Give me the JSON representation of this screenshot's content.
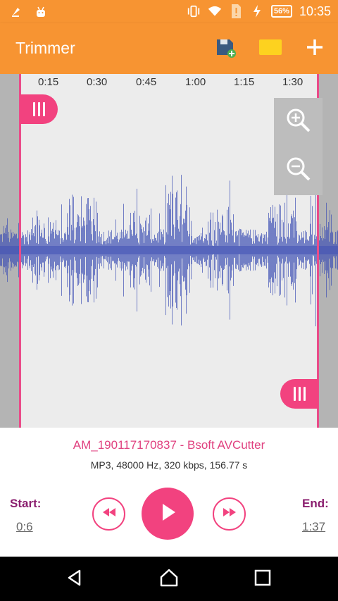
{
  "status_bar": {
    "icons": [
      "download-arrow-icon",
      "android-icon",
      "vibrate-icon",
      "wifi-icon",
      "sim-alert-icon",
      "charging-icon"
    ],
    "battery": "56%",
    "time": "10:35"
  },
  "app_bar": {
    "title": "Trimmer",
    "actions": [
      "save-icon",
      "folder-icon",
      "add-icon"
    ]
  },
  "timeline": {
    "ticks": [
      "0:15",
      "0:30",
      "0:45",
      "1:00",
      "1:15",
      "1:30"
    ]
  },
  "zoom": {
    "icons": [
      "zoom-in-icon",
      "zoom-out-icon"
    ]
  },
  "file": {
    "name": "AM_190117170837 - Bsoft AVCutter",
    "info": "MP3, 48000 Hz, 320 kbps, 156.77 s"
  },
  "controls": {
    "start_label": "Start:",
    "start_value": "0:6",
    "end_label": "End:",
    "end_value": "1:37",
    "icons": [
      "rewind-icon",
      "play-icon",
      "fast-forward-icon"
    ]
  },
  "nav_bar": {
    "icons": [
      "back-icon",
      "home-icon",
      "recents-icon"
    ]
  },
  "colors": {
    "accent_orange": "#f79432",
    "accent_pink": "#f2427f",
    "waveform": "#3f51b5",
    "label_purple": "#8b1f6f"
  }
}
